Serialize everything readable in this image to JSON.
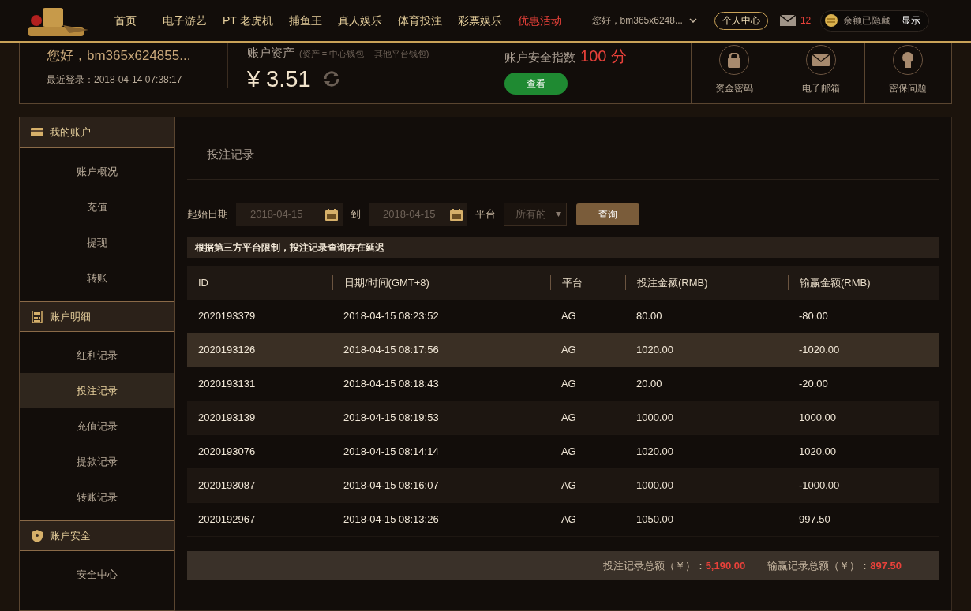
{
  "header": {
    "nav": [
      {
        "label": "首页",
        "kind": "normal"
      },
      {
        "label": "电子游艺",
        "kind": "normal"
      },
      {
        "label": "PT 老虎机",
        "kind": "normal"
      },
      {
        "label": "捕鱼王",
        "kind": "normal"
      },
      {
        "label": "真人娱乐",
        "kind": "normal"
      },
      {
        "label": "体育投注",
        "kind": "normal"
      },
      {
        "label": "彩票娱乐",
        "kind": "normal"
      },
      {
        "label": "优惠活动",
        "kind": "promo"
      }
    ],
    "user": "您好，bm365x6248...",
    "center_button": "个人中心",
    "mail_count": "12",
    "balance_status": "余额已隐藏",
    "show_button": "显示"
  },
  "account": {
    "greeting": "您好，bm365x624855...",
    "last_login": "最近登录：2018-04-14 07:38:17",
    "assets_label": "账户资产",
    "assets_note": "(资产 = 中心钱包 + 其他平台钱包)",
    "balance": "¥ 3.51",
    "security_label": "账户安全指数",
    "security_score": "100 分",
    "view_button": "查看",
    "security_items": [
      {
        "kind": "lock",
        "label": "资金密码"
      },
      {
        "kind": "mail",
        "label": "电子邮箱"
      },
      {
        "kind": "bulb",
        "label": "密保问题"
      }
    ]
  },
  "sidebar": [
    {
      "title": "我的账户",
      "kind": "card",
      "items": [
        {
          "label": "账户概况",
          "selected": false
        },
        {
          "label": "充值",
          "selected": false
        },
        {
          "label": "提现",
          "selected": false
        },
        {
          "label": "转账",
          "selected": false
        }
      ]
    },
    {
      "title": "账户明细",
      "kind": "calc",
      "items": [
        {
          "label": "红利记录",
          "selected": false
        },
        {
          "label": "投注记录",
          "selected": true
        },
        {
          "label": "充值记录",
          "selected": false
        },
        {
          "label": "提款记录",
          "selected": false
        },
        {
          "label": "转账记录",
          "selected": false
        }
      ]
    },
    {
      "title": "账户安全",
      "kind": "shield",
      "items": [
        {
          "label": "安全中心",
          "selected": false
        }
      ]
    }
  ],
  "main": {
    "title": "投注记录",
    "filter": {
      "start_label": "起始日期",
      "start_value": "2018-04-15",
      "to_label": "到",
      "end_value": "2018-04-15",
      "platform_label": "平台",
      "platform_value": "所有的",
      "query_button": "查询"
    },
    "notice": "根据第三方平台限制，投注记录查询存在延迟",
    "table": {
      "columns": [
        "ID",
        "日期/时间(GMT+8)",
        "平台",
        "投注金额(RMB)",
        "输赢金额(RMB)"
      ],
      "rows": [
        {
          "cells": [
            "2020193379",
            "2018-04-15 08:23:52",
            "AG",
            "80.00",
            "-80.00"
          ],
          "selected": false
        },
        {
          "cells": [
            "2020193126",
            "2018-04-15 08:17:56",
            "AG",
            "1020.00",
            "-1020.00"
          ],
          "selected": true
        },
        {
          "cells": [
            "2020193131",
            "2018-04-15 08:18:43",
            "AG",
            "20.00",
            "-20.00"
          ],
          "selected": false
        },
        {
          "cells": [
            "2020193139",
            "2018-04-15 08:19:53",
            "AG",
            "1000.00",
            "1000.00"
          ],
          "selected": false
        },
        {
          "cells": [
            "2020193076",
            "2018-04-15 08:14:14",
            "AG",
            "1020.00",
            "1020.00"
          ],
          "selected": false
        },
        {
          "cells": [
            "2020193087",
            "2018-04-15 08:16:07",
            "AG",
            "1000.00",
            "-1000.00"
          ],
          "selected": false
        },
        {
          "cells": [
            "2020192967",
            "2018-04-15 08:13:26",
            "AG",
            "1050.00",
            "997.50"
          ],
          "selected": false
        }
      ]
    },
    "totals": [
      {
        "label": "投注记录总额（￥）：",
        "value": "5,190.00"
      },
      {
        "label": "输赢记录总额（￥）：",
        "value": "897.50"
      }
    ]
  }
}
